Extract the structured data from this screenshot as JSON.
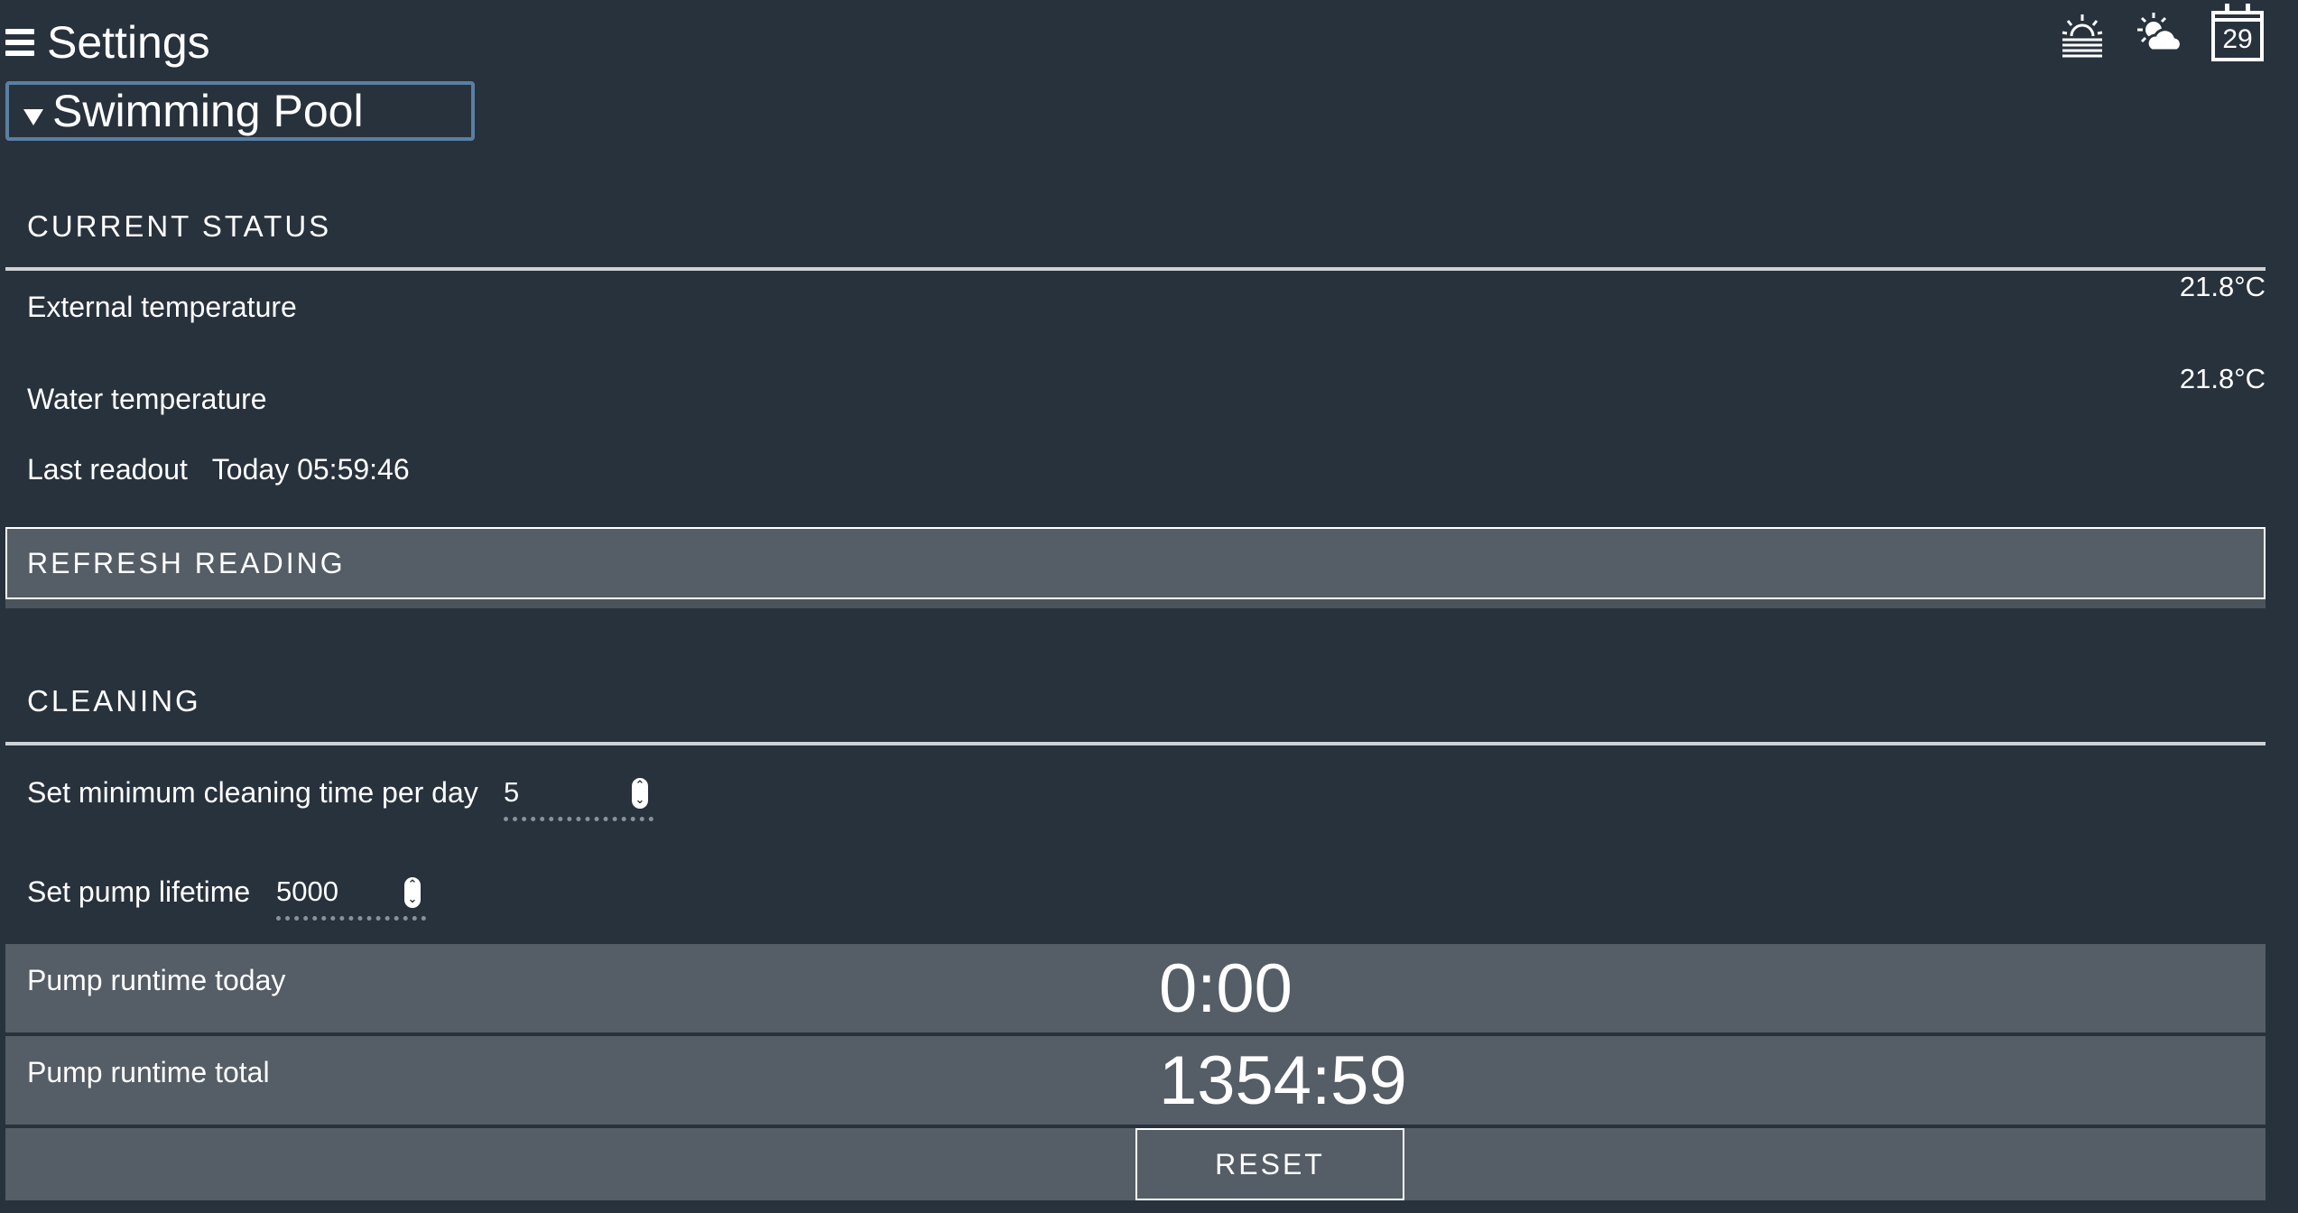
{
  "header": {
    "title": "Settings",
    "icons": [
      "menu-icon",
      "sunrise-icon",
      "weather-icon",
      "calendar-icon"
    ],
    "calendar_day": "29"
  },
  "location_select": {
    "selected": "Swimming Pool"
  },
  "current_status": {
    "title": "CURRENT STATUS",
    "external_temperature_label": "External temperature",
    "external_temperature_value": "21.8°C",
    "water_temperature_label": "Water temperature",
    "water_temperature_value": "21.8°C",
    "last_readout_label": "Last readout",
    "last_readout_value": "Today 05:59:46",
    "refresh_button": "REFRESH READING"
  },
  "cleaning": {
    "title": "CLEANING",
    "min_cleaning_label": "Set minimum cleaning time per day",
    "min_cleaning_value": "5",
    "pump_lifetime_label": "Set pump lifetime",
    "pump_lifetime_value": "5000",
    "runtime_today_label": "Pump runtime today",
    "runtime_today_value": "0:00",
    "runtime_total_label": "Pump runtime total",
    "runtime_total_value": "1354:59",
    "reset_button": "RESET"
  },
  "colors": {
    "background": "#28323d",
    "panel": "#555d66",
    "select_border": "#5a7fa3"
  }
}
